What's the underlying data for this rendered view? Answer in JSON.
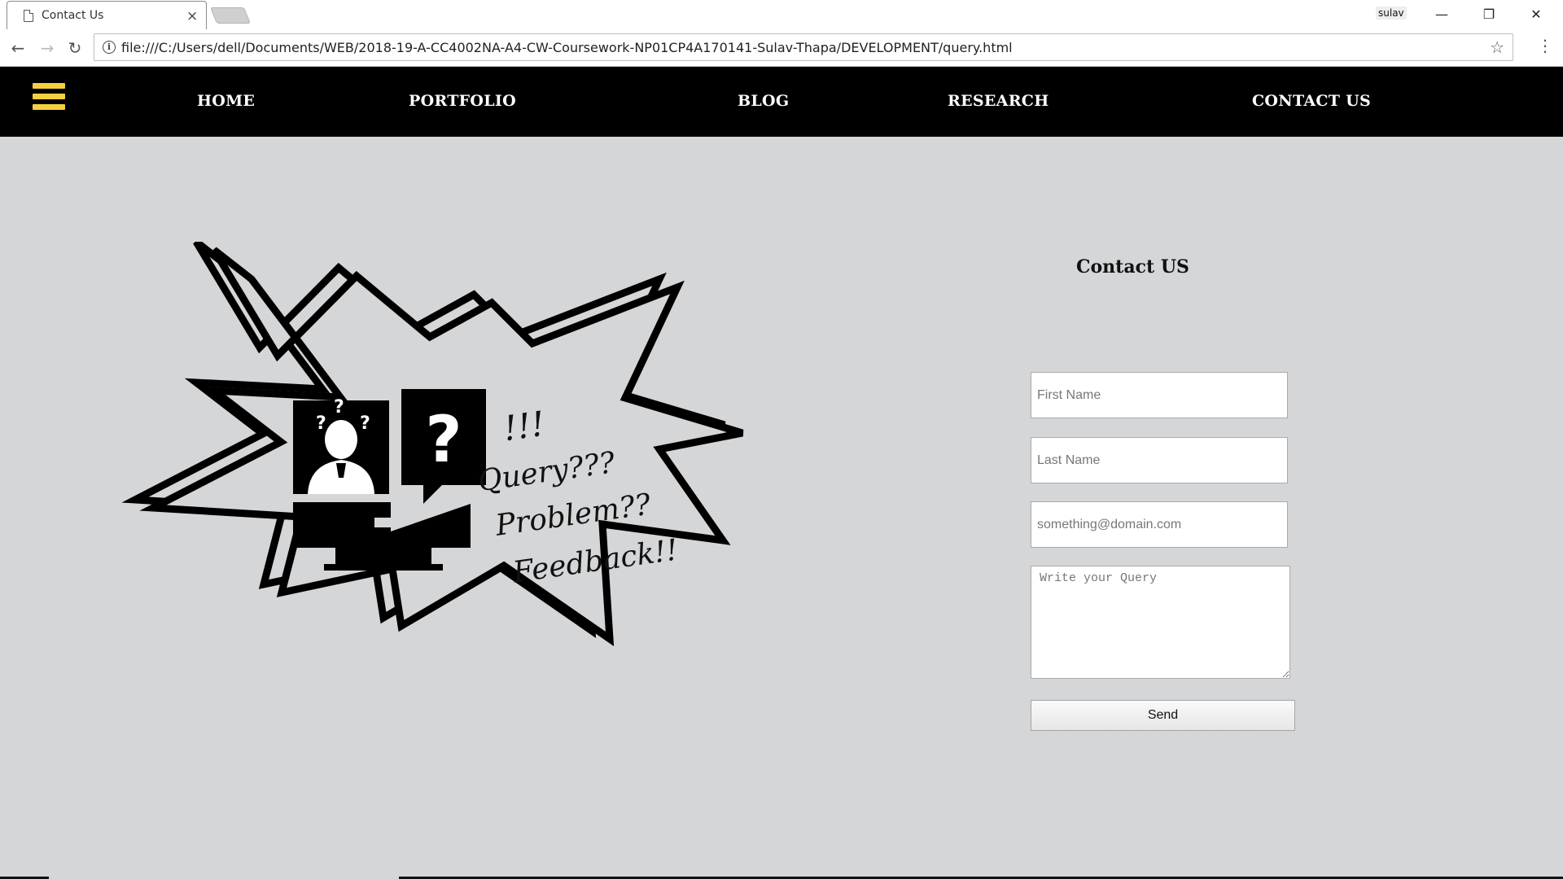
{
  "browser": {
    "tab_title": "Contact Us",
    "tab_close": "×",
    "profile_name": "sulav",
    "url": "file:///C:/Users/dell/Documents/WEB/2018-19-A-CC4002NA-A4-CW-Coursework-NP01CP4A170141-Sulav-Thapa/DEVELOPMENT/query.html",
    "window_minimize": "—",
    "window_restore": "❐",
    "window_close": "✕",
    "back": "←",
    "forward": "→",
    "reload": "↻",
    "info": "i",
    "bookmark": "☆",
    "menu": "⋮"
  },
  "nav": {
    "items": [
      {
        "label": "HOME"
      },
      {
        "label": "PORTFOLIO"
      },
      {
        "label": "BLOG"
      },
      {
        "label": "RESEARCH"
      },
      {
        "label": "CONTACT US"
      }
    ],
    "accent_color": "#f4d03f"
  },
  "illustration": {
    "line1": "!!!",
    "line2": "Query???",
    "line3": "Problem??",
    "line4": "Feedback!!"
  },
  "form": {
    "title": "Contact US",
    "first_name_placeholder": "First Name",
    "last_name_placeholder": "Last Name",
    "email_placeholder": "something@domain.com",
    "query_placeholder": "Write your Query",
    "send_label": "Send"
  }
}
